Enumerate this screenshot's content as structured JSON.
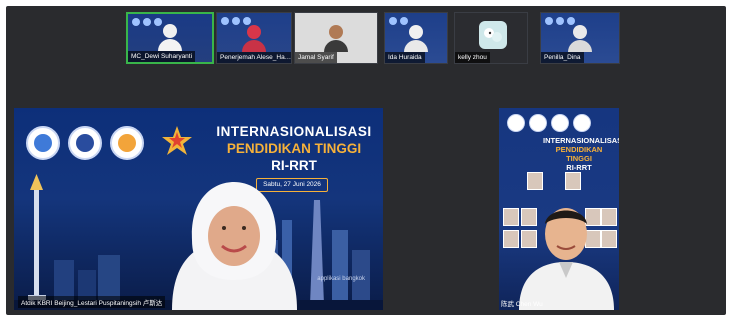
{
  "participants": [
    {
      "name": "MC_Dewi Suharyanti",
      "active": true
    },
    {
      "name": "Penerjemah Alese_Ha…",
      "active": false
    },
    {
      "name": "Jamal Syarif",
      "active": false
    },
    {
      "name": "Ida Huraida",
      "active": false
    },
    {
      "name": "kelly zhou",
      "active": false
    },
    {
      "name": "Penilla_Dina",
      "active": false
    }
  ],
  "main_tile": {
    "title_line1": "INTERNASIONALISASI",
    "title_line2": "PENDIDIKAN TINGGI",
    "title_line3": "RI-RRT",
    "date": "Sabtu, 27 Juni 2026",
    "label": "Atdik KBRI Beijing_Lestari Puspitaningsih 卢斯达",
    "watermark": "applikasi bangkok"
  },
  "right_tile": {
    "title_line1": "INTERNASIONALISASI",
    "title_line2": "PENDIDIKAN TINGGI",
    "title_line3": "RI-RRT",
    "label": "陈武 Chen Wu"
  },
  "colors": {
    "active_border": "#39b54a",
    "accent": "#f6b13a",
    "banner_blue": "#0d2f7a"
  }
}
